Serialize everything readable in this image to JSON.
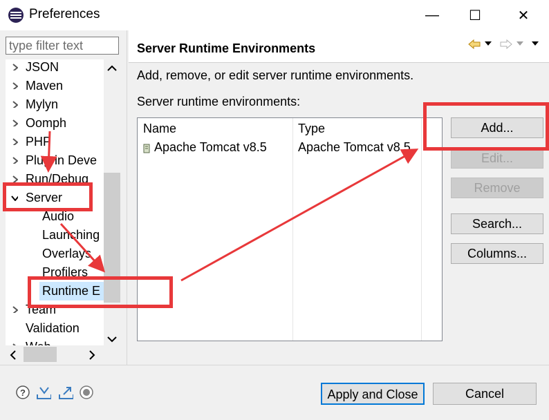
{
  "window": {
    "title": "Preferences",
    "minimize": "—",
    "maximize": "☐",
    "close": "✕"
  },
  "filter": {
    "placeholder": "type filter text"
  },
  "tree": {
    "items": [
      {
        "label": "JSON",
        "level": 0,
        "expander": "collapsed"
      },
      {
        "label": "Maven",
        "level": 0,
        "expander": "collapsed"
      },
      {
        "label": "Mylyn",
        "level": 0,
        "expander": "collapsed"
      },
      {
        "label": "Oomph",
        "level": 0,
        "expander": "collapsed"
      },
      {
        "label": "PHP",
        "level": 0,
        "expander": "collapsed"
      },
      {
        "label": "Plug-in Deve",
        "level": 0,
        "expander": "collapsed"
      },
      {
        "label": "Run/Debug",
        "level": 0,
        "expander": "collapsed"
      },
      {
        "label": "Server",
        "level": 0,
        "expander": "expanded"
      },
      {
        "label": "Audio",
        "level": 1,
        "expander": "none"
      },
      {
        "label": "Launching",
        "level": 1,
        "expander": "none"
      },
      {
        "label": "Overlays",
        "level": 1,
        "expander": "none"
      },
      {
        "label": "Profilers",
        "level": 1,
        "expander": "none"
      },
      {
        "label": "Runtime E",
        "level": 1,
        "expander": "none",
        "selected": true
      },
      {
        "label": "Team",
        "level": 0,
        "expander": "collapsed"
      },
      {
        "label": "Validation",
        "level": 0,
        "expander": "none"
      },
      {
        "label": "Web",
        "level": 0,
        "expander": "collapsed"
      }
    ]
  },
  "page": {
    "title": "Server Runtime Environments",
    "description": "Add, remove, or edit server runtime environments.",
    "list_label": "Server runtime environments:"
  },
  "table": {
    "columns": [
      "Name",
      "Type"
    ],
    "rows": [
      {
        "name": "Apache Tomcat v8.5",
        "type": "Apache Tomcat v8.5",
        "icon": "server-runtime-icon"
      }
    ]
  },
  "buttons": {
    "add": "Add...",
    "edit": "Edit...",
    "remove": "Remove",
    "search": "Search...",
    "columns": "Columns...",
    "apply_close": "Apply and Close",
    "cancel": "Cancel"
  },
  "nav": {
    "back": "back-arrow-icon",
    "forward": "forward-arrow-icon"
  },
  "bottom_icons": [
    "help-icon",
    "import-icon",
    "export-icon",
    "record-icon"
  ],
  "colors": {
    "annotation": "#e8383a",
    "selection": "#cce8ff",
    "accent": "#0078d7"
  }
}
